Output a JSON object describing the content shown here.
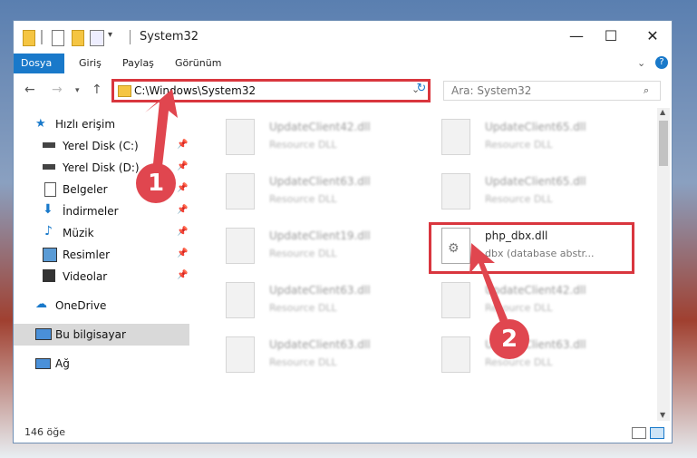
{
  "window": {
    "title": "System32"
  },
  "ribbon": {
    "tabs": [
      "Dosya",
      "Giriş",
      "Paylaş",
      "Görünüm"
    ]
  },
  "address": {
    "path": "C:\\Windows\\System32"
  },
  "search": {
    "placeholder": "Ara: System32"
  },
  "sidebar": {
    "quick_access": "Hızlı erişim",
    "items": [
      "Yerel Disk (C:)",
      "Yerel Disk (D:)",
      "Belgeler",
      "İndirmeler",
      "Müzik",
      "Resimler",
      "Videolar"
    ],
    "onedrive": "OneDrive",
    "this_pc": "Bu bilgisayar",
    "network": "Ağ"
  },
  "files": [
    {
      "name": "UpdateClient42.dll",
      "desc": "Resource DLL"
    },
    {
      "name": "UpdateClient65.dll",
      "desc": "Resource DLL"
    },
    {
      "name": "UpdateClient63.dll",
      "desc": "Resource DLL"
    },
    {
      "name": "UpdateClient65.dll",
      "desc": "Resource DLL"
    },
    {
      "name": "UpdateClient19.dll",
      "desc": "Resource DLL"
    },
    {
      "name": "php_dbx.dll",
      "desc": "dbx (database abstr..."
    },
    {
      "name": "UpdateClient63.dll",
      "desc": "Resource DLL"
    },
    {
      "name": "UpdateClient42.dll",
      "desc": "Resource DLL"
    },
    {
      "name": "UpdateClient63.dll",
      "desc": "Resource DLL"
    },
    {
      "name": "UpdateClient63.dll",
      "desc": "Resource DLL"
    }
  ],
  "status": {
    "count": "146 öğe"
  },
  "callouts": [
    "1",
    "2"
  ],
  "colors": {
    "accent": "#1979ca",
    "highlight": "#d9363e",
    "callout": "#e0464f"
  }
}
